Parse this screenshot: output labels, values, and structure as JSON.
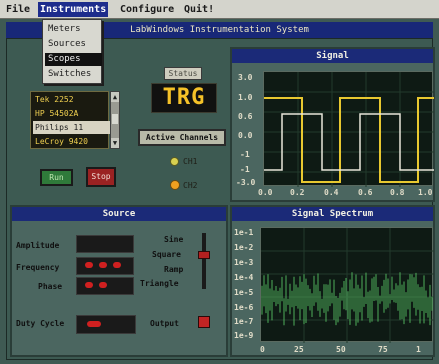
{
  "menubar": {
    "items": [
      {
        "label": "File"
      },
      {
        "label": "Instruments"
      },
      {
        "label": "Configure"
      },
      {
        "label": "Quit!"
      }
    ]
  },
  "dropdown": {
    "items": [
      {
        "label": "Meters"
      },
      {
        "label": "Sources"
      },
      {
        "label": "Scopes"
      },
      {
        "label": "Switches"
      }
    ],
    "selected_label": "Scopes"
  },
  "window": {
    "title": "LabWindows Instrumentation System"
  },
  "instrument_list": {
    "items": [
      {
        "label": "Tek 2252"
      },
      {
        "label": "HP 54502A"
      },
      {
        "label": "Philips 11"
      },
      {
        "label": "LeCroy 9420"
      }
    ],
    "selected_label": "Philips 11"
  },
  "buttons": {
    "run_label": "Run",
    "stop_label": "Stop"
  },
  "status": {
    "label": "Status",
    "value": "TRG",
    "active_channels_label": "Active Channels",
    "ch1_label": "CH1",
    "ch2_label": "CH2"
  },
  "signal": {
    "title": "Signal",
    "y_ticks": [
      "3.0",
      "1.0",
      "0.6",
      "0.0",
      "-1",
      "-1",
      "-3.0"
    ],
    "x_ticks": [
      "0.0",
      "0.2",
      "0.4",
      "0.6",
      "0.8",
      "1.0"
    ]
  },
  "source": {
    "title": "Source",
    "amplitude_label": "Amplitude",
    "frequency_label": "Frequency",
    "phase_label": "Phase",
    "duty_cycle_label": "Duty Cycle",
    "output_label": "Output",
    "waveforms": [
      "Sine",
      "Square",
      "Ramp",
      "Triangle"
    ],
    "selected_waveform": "Square"
  },
  "spectrum": {
    "title": "Signal Spectrum",
    "y_ticks": [
      "1e-1",
      "1e-2",
      "1e-3",
      "1e-4",
      "1e-5",
      "1e-6",
      "1e-7",
      "1e-9"
    ],
    "x_ticks": [
      "0",
      "25",
      "50",
      "75",
      "1"
    ]
  },
  "colors": {
    "menu_highlight": "#1d2c8c",
    "trace_yellow": "#e8c830",
    "trace_white": "#e8e6da",
    "spectrum_green": "#4fae5a",
    "led_yellow": "#d8d050",
    "led_orange": "#f0a020",
    "stop_red": "#9a2222",
    "run_green": "#2f7a3a"
  }
}
